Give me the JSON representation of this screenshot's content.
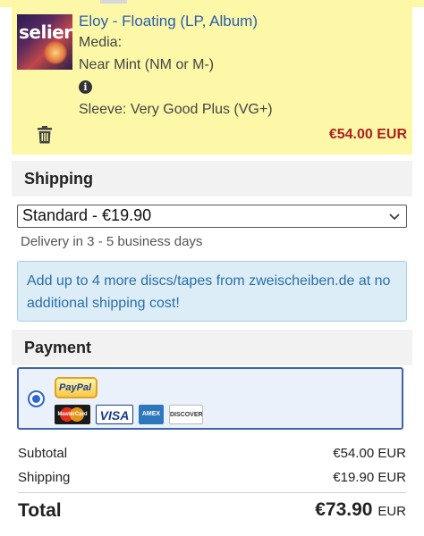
{
  "cart_item": {
    "cover_text": "selier",
    "title": "Eloy - Floating (LP, Album)",
    "media_label": "Media:",
    "media_condition": "Near Mint (NM or M-)",
    "sleeve": "Sleeve: Very Good Plus (VG+)",
    "price": "€54.00 EUR",
    "icons": {
      "info": "info-icon",
      "delete": "trash-icon"
    }
  },
  "shipping": {
    "heading": "Shipping",
    "selected_option": "Standard - €19.90",
    "delivery_time": "Delivery in 3 - 5 business days",
    "notice": "Add up to 4 more discs/tapes from zweischeiben.de at no additional shipping cost!"
  },
  "payment": {
    "heading": "Payment",
    "method": {
      "selected": true,
      "paypal_label": "PayPal",
      "cards": [
        "MasterCard",
        "VISA",
        "AMEX",
        "DISCOVER"
      ]
    }
  },
  "totals": {
    "subtotal_label": "Subtotal",
    "subtotal_value": "€54.00 EUR",
    "shipping_label": "Shipping",
    "shipping_value": "€19.90 EUR",
    "total_label": "Total",
    "total_amount": "€73.90",
    "total_currency": "EUR"
  },
  "colors": {
    "item_highlight": "#fcf8a8",
    "link": "#2a5db0",
    "price": "#b02020",
    "notice_bg": "#dcedf8",
    "selected_border": "#3f63a8"
  }
}
